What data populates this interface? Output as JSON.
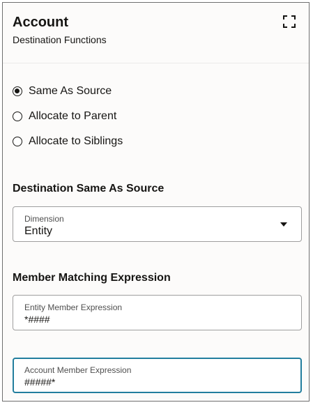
{
  "header": {
    "title": "Account",
    "subtitle": "Destination Functions"
  },
  "radio_options": [
    {
      "label": "Same As Source",
      "checked": true
    },
    {
      "label": "Allocate to Parent",
      "checked": false
    },
    {
      "label": "Allocate to Siblings",
      "checked": false
    }
  ],
  "destination_section": {
    "title": "Destination Same As Source",
    "dimension": {
      "label": "Dimension",
      "value": "Entity"
    }
  },
  "matching_section": {
    "title": "Member Matching Expression",
    "entity_expression": {
      "label": "Entity Member Expression",
      "value": "*####"
    },
    "account_expression": {
      "label": "Account Member Expression",
      "value": "#####*"
    }
  },
  "colors": {
    "focus_border": "#227e9e",
    "panel_background": "#fcfbfa"
  },
  "icons": {
    "expand": "expand-icon",
    "dropdown": "chevron-down-icon"
  }
}
